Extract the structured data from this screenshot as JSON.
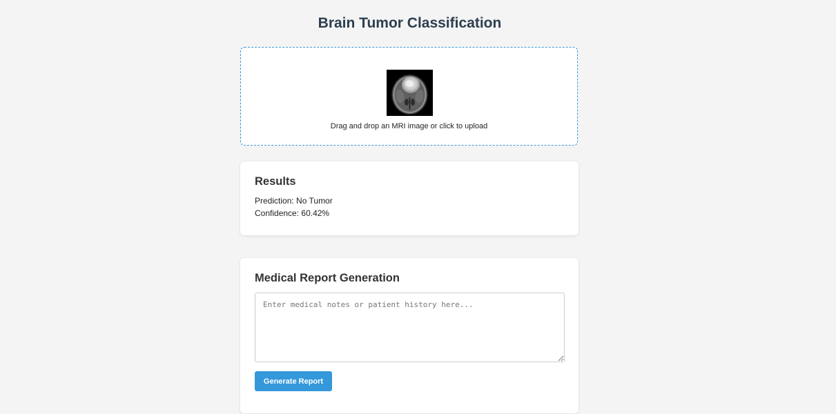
{
  "header": {
    "title": "Brain Tumor Classification"
  },
  "upload": {
    "image_name": "mri-scan-preview",
    "hint": "Drag and drop an MRI image or click to upload",
    "border_color": "#3498db"
  },
  "results": {
    "heading": "Results",
    "prediction_label": "Prediction:",
    "prediction_value": "No Tumor",
    "confidence_label": "Confidence:",
    "confidence_value": "60.42%"
  },
  "report": {
    "heading": "Medical Report Generation",
    "textarea_value": "",
    "textarea_placeholder": "Enter medical notes or patient history here...",
    "generate_label": "Generate Report",
    "button_color": "#3498db"
  },
  "theme": {
    "page_background": "#f4f4f4",
    "title_color": "#2c3e50",
    "card_background": "#ffffff"
  }
}
